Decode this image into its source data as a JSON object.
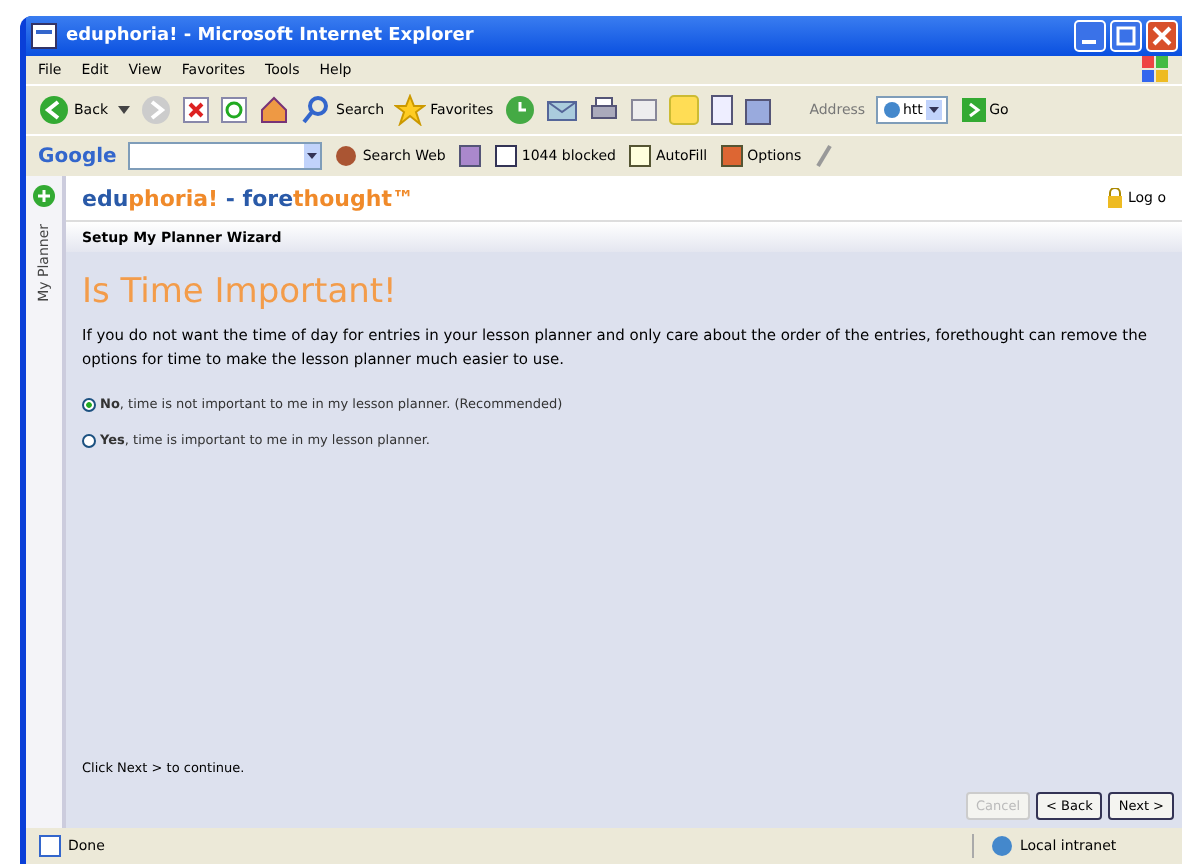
{
  "window": {
    "title": "eduphoria! - Microsoft Internet Explorer"
  },
  "menu": [
    "File",
    "Edit",
    "View",
    "Favorites",
    "Tools",
    "Help"
  ],
  "toolbar": {
    "back": "Back",
    "search": "Search",
    "favorites": "Favorites",
    "address_label": "Address",
    "address_value": "htt",
    "go": "Go"
  },
  "google_bar": {
    "logo": "Google",
    "search_web": "Search Web",
    "blocked": "1044 blocked",
    "autofill": "AutoFill",
    "options": "Options"
  },
  "side_tab": "My Planner",
  "logo_parts": [
    {
      "text": "edu",
      "color": "#2a5aa8"
    },
    {
      "text": "phoria!",
      "color": "#f08a2a"
    },
    {
      "text": " - fore",
      "color": "#2a5aa8"
    },
    {
      "text": "thought",
      "color": "#f08a2a"
    },
    {
      "text": "™",
      "color": "#f08a2a"
    }
  ],
  "log_link": "Log o",
  "wizard_title": "Setup My Planner Wizard",
  "heading": "Is Time Important!",
  "description": "If you do not want the time of day for entries in your lesson planner and only care about the order of the entries, forethought can remove the options for time to make the lesson planner much easier to use.",
  "options": [
    {
      "label": "**No**, time is not important to me in my lesson planner. (Recommended)",
      "selected": true
    },
    {
      "label": "**Yes**, time is important to me in my lesson planner.",
      "selected": false
    }
  ],
  "hint": "Click Next > to continue.",
  "buttons": [
    {
      "label": "Cancel",
      "disabled": true
    },
    {
      "label": "< Back",
      "disabled": false
    },
    {
      "label": "Next >",
      "disabled": false
    }
  ],
  "status_bar": {
    "text": "Done",
    "zone": "Local intranet"
  }
}
